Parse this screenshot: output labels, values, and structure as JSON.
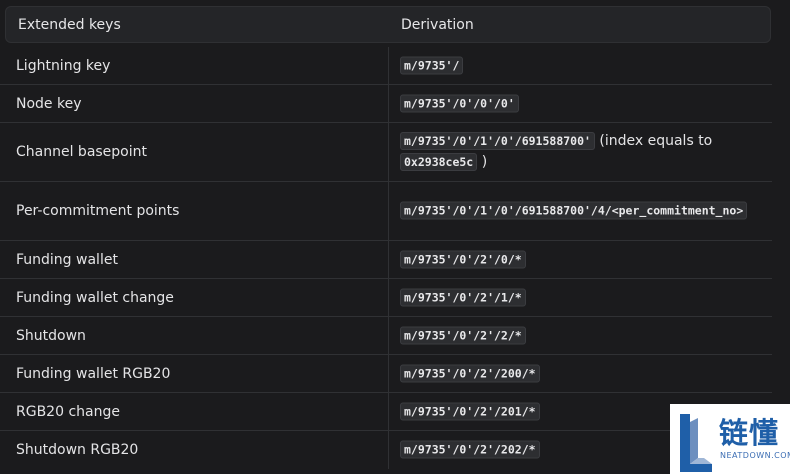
{
  "header": {
    "col1": "Extended keys",
    "col2": "Derivation"
  },
  "rows": [
    {
      "label": "Lightning key",
      "code": "m/9735'/",
      "after": ""
    },
    {
      "label": "Node key",
      "code": "m/9735'/0'/0'/0'",
      "after": ""
    },
    {
      "label": "Channel basepoint",
      "code": "m/9735'/0'/1'/0'/691588700'",
      "after": " (index equals to ",
      "code2": "0x2938ce5c",
      "after2": " )"
    },
    {
      "label": "Per-commitment points",
      "code": "m/9735'/0'/1'/0'/691588700'/4/<per_commitment_no>",
      "after": ""
    },
    {
      "label": "Funding wallet",
      "code": "m/9735'/0'/2'/0/*",
      "after": ""
    },
    {
      "label": "Funding wallet change",
      "code": "m/9735'/0'/2'/1/*",
      "after": ""
    },
    {
      "label": "Shutdown",
      "code": "m/9735'/0'/2'/2/*",
      "after": ""
    },
    {
      "label": "Funding wallet RGB20",
      "code": "m/9735'/0'/2'/200/*",
      "after": ""
    },
    {
      "label": "RGB20 change",
      "code": "m/9735'/0'/2'/201/*",
      "after": ""
    },
    {
      "label": "Shutdown RGB20",
      "code": "m/9735'/0'/2'/202/*",
      "after": ""
    }
  ],
  "watermark": {
    "chinese": "链懂",
    "english": "NEATDOWN.COM",
    "color": "#1f5fa8"
  }
}
